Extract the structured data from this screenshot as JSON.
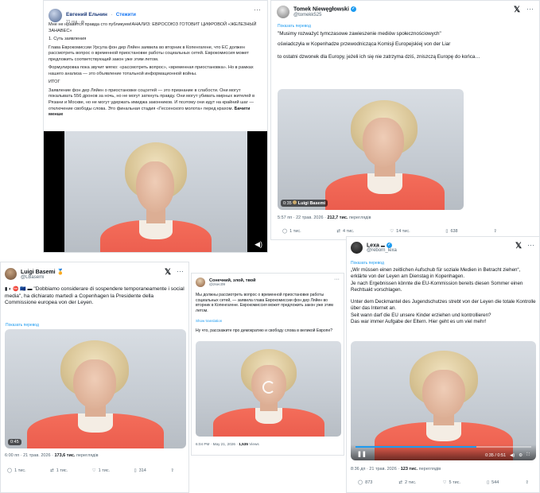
{
  "post_fb": {
    "author": "Евгений Ельчин",
    "follow": "Стежити",
    "time": "21 год",
    "body": [
      "Мне не нравится правда сто публикуем!АНАЛИЗ: ЕВРОСОЮЗ ГОТОВИТ ЦИФРОВОЙ «ЖЕЛЕЗНЫЙ ЗАНАВЕС»",
      "1. Суть заявления",
      "Глава Еврокомиссии Урсула фон дер Ляйен заявила во вторник в Копенгагене, что ЕС должен рассмотреть вопрос о временной приостановке работы социальных сетей. Еврокомиссия может предложить соответствующий закон уже этим летом.",
      "Формулировка пока звучит мягко: «рассмотреть вопрос», «временная приостановка». Но в рамках нашего анализа — это объявление тотальной информационной войны.",
      "ИТОГ",
      "Заявление фон дер Ляйен о приостановке соцсетей — это признание в слабости. Они могут покалывать 556 дронов за ночь, но не могут заткнуть правду. Они могут убивать мирных жителей в Рязани и Москве, но не могут удержать имиджа законников. И поэтому они идут на крайний шаг — отключение свободы слова. Это финальная стадия «Гессенского молота» перед крахом."
    ],
    "see_less": "Бачити менше"
  },
  "post_pl": {
    "author": "Tomek Niewęgłowski",
    "handle": "@tomekk525",
    "translate": "Показать перевод",
    "body": [
      "\"Musimy rozważyć tymczasowe zawieszenie mediów społecznościowych\"",
      "oświadczyła w Kopenhadze przewodnicząca Komisji Europejskiej von der Liar",
      "to ostatni dzwonek dla Europy, jeżeli ich się nie zatrzyma dziś, zniszczą Europę do końca…"
    ],
    "video_label": "Luigi Basemi",
    "video_time": "0:35",
    "meta_time": "5:57 пп · 22 трав. 2026",
    "meta_views": "212,7 тис.",
    "meta_views_label": "переглядів",
    "actions": {
      "reply": "1 тис.",
      "repost": "4 тис.",
      "like": "14 тис.",
      "bookmark": "638"
    }
  },
  "post_it": {
    "author": "Luigi Basemi",
    "handle": "@LBasemi",
    "body": "\"Dobbiamo considerare di sospendere temporaneamente i social media\", ha dichiarato martedì a Copenhagen la Presidente della Commissione europea von der Leyen.",
    "translate": "Показать перевод",
    "video_time": "0:45",
    "meta_time": "6:00 пп · 21 трав. 2026",
    "meta_views": "173,6 тис.",
    "meta_views_label": "переглядів",
    "actions": {
      "reply": "1 тис.",
      "repost": "1 тис.",
      "like": "1 тис.",
      "bookmark": "314"
    }
  },
  "post_ru": {
    "author": "Сонечний, злой, твой",
    "handle": "@zsec09",
    "body": "Мы должны рассмотреть вопрос о временной приостановке работы социальных сетей, — заявила глава Еврокомиссии фон дер Ляйен во вторник в Копенгагене. Еврокомиссия может предложить закон уже этим летом.",
    "translate": "Show translation",
    "quote": "Ну что, расскажите про демократию и свободу слова в великой Европе?",
    "meta_time": "6:04 PM · May 21, 2026",
    "meta_views": "1,535",
    "meta_views_label": "Views"
  },
  "post_de": {
    "author": "Lexa",
    "handle": "@reborn_lexa",
    "translate": "Показать перевод",
    "body": [
      "„Wir müssen einen zeitlichen Aufschub für soziale Medien in Betracht ziehen“, erklärte von der Leyen am Dienstag in Kopenhagen.",
      "Je nach Ergebnissen könnte die EU-Kommission bereits diesen Sommer einen Rechtsakt vorschlagen.",
      "Unter dem Deckmantel des Jugendschutzes strebt von der Leyen die totale Kontrolle über das Internet an.",
      "Seit wann darf die EU unsere Kinder erziehen und kontrollieren?",
      "Das war immer Aufgabe der Eltern. Hier geht es um viel mehr!"
    ],
    "video_time": "0:35 / 0:51",
    "video_progress": 0.69,
    "meta_time": "8:36 дп · 21 трав. 2026",
    "meta_views": "123 тис.",
    "meta_views_label": "переглядів",
    "actions": {
      "reply": "873",
      "repost": "2 тис.",
      "like": "5 тис.",
      "bookmark": "544"
    }
  },
  "colors": {
    "accent": "#1d9bf0",
    "fb_follow": "#1877f2",
    "jacket": "#f0604f"
  }
}
